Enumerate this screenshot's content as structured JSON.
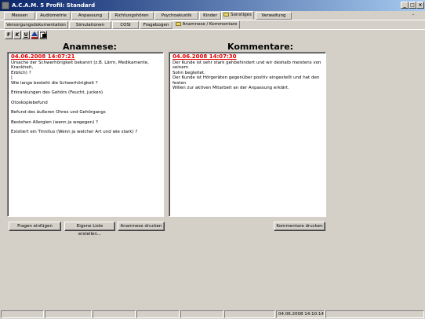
{
  "window": {
    "title": "A.C.A.M. 5 Profil: Standard",
    "buttons": {
      "minimize": "_",
      "maximize": "□",
      "close": "×"
    },
    "mdi_restore": "-"
  },
  "tabs_row1": [
    "Messen",
    "Audiometrie",
    "Anpassung",
    "Richtungshören",
    "Psychoakustik",
    "Kinder",
    "Sonstiges",
    "Verwaltung"
  ],
  "tabs_row2": [
    "Versorgungsdokumentation",
    "Simulationen",
    "COSI",
    "Fragebogen",
    "Anamnese / Kommentare"
  ],
  "toolbar": {
    "bold": "F",
    "italic": "K",
    "underline": "U"
  },
  "anamnese": {
    "heading": "Anamnese:",
    "date": "04.06.2008 14:07:21",
    "lines": [
      "Ursache der Schwerhörigkeit bekannt (z.B. Lärm, Medikamente, Krankheit,",
      "Erblich) ?",
      "|",
      "Wie lange besteht die Schwerhörigkeit ?",
      "",
      "Erkrankungen des Gehörs (Feucht, jucken)",
      "",
      "Otoskopiebefund",
      "",
      "Befund des äußeren Ohres und Gehörgangs",
      "",
      "Bestehen Allergien (wenn ja wogegen) ?",
      "",
      "Existiert ein Tinnitus (Wenn ja welcher Art und wie stark) ?"
    ]
  },
  "kommentare": {
    "heading": "Kommentare:",
    "date": "04.06.2008 14:07:30",
    "lines": [
      "Der Kunde ist sehr stark gehbehindert und wir deshalb meistens von seinem",
      "Sohn begleitet.",
      "Der Kunde ist Hörgeräten gegenüber positiv eingestellt und hat den festen",
      "Willen zur aktiven Mitarbeit an der Anpassung erklärt."
    ]
  },
  "buttons": {
    "fragen_einfuegen": "Fragen einfügen",
    "eigene_liste": "Eigene Liste erstellen...",
    "anamnese_drucken": "Anamnese drucken",
    "kommentare_drucken": "Kommentare drucken"
  },
  "statusbar": {
    "datetime": "04.06.2008 14:10:14"
  }
}
